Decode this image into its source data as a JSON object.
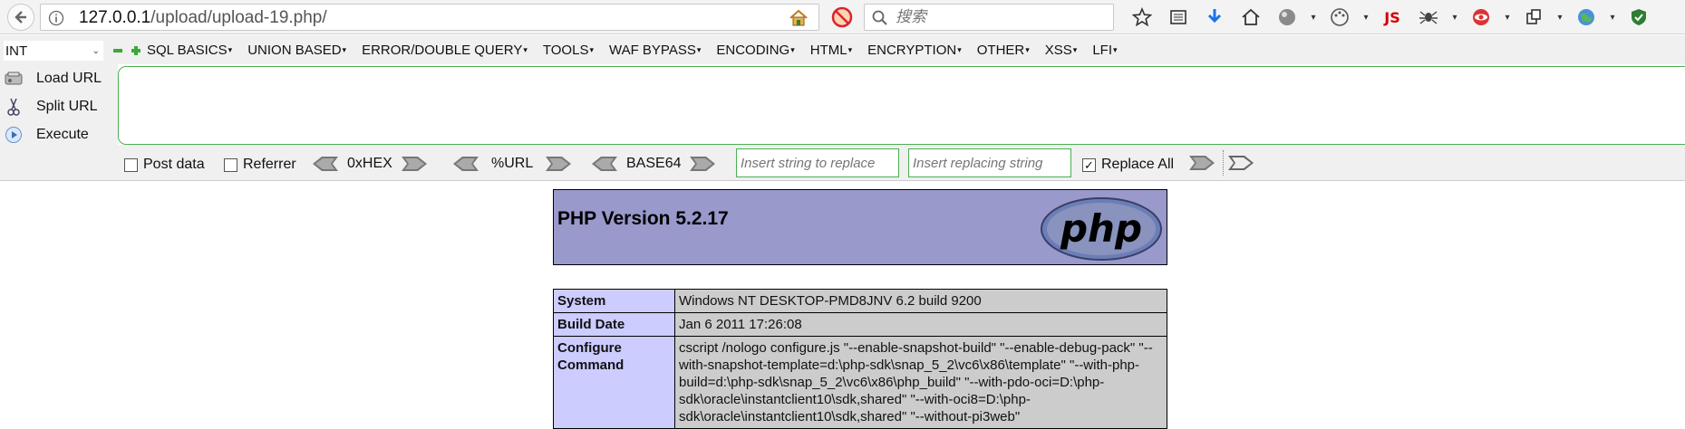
{
  "browser": {
    "url_host": "127.0.0.1",
    "url_path": "/upload/upload-19.php/",
    "search_placeholder": "搜索",
    "toolbar_icons": [
      "star-icon",
      "reader-icon",
      "download-icon",
      "home-icon",
      "addon-globe-icon",
      "palette-icon",
      "js-badge",
      "spider-icon",
      "eye-icon",
      "screenshot-icon",
      "globe-icon",
      "shield-icon"
    ],
    "js_label": "JS"
  },
  "hackbar": {
    "int_select": "INT",
    "menus": [
      "SQL BASICS",
      "UNION BASED",
      "ERROR/DOUBLE QUERY",
      "TOOLS",
      "WAF BYPASS",
      "ENCODING",
      "HTML",
      "ENCRYPTION",
      "OTHER",
      "XSS",
      "LFI"
    ],
    "actions": {
      "load_url": "Load URL",
      "split_url": "Split URL",
      "execute": "Execute"
    },
    "url_value": "",
    "post_data": "Post data",
    "referrer": "Referrer",
    "hex": "0xHEX",
    "url_enc": "%URL",
    "base64": "BASE64",
    "replace_placeholder": "Insert string to replace",
    "replacing_placeholder": "Insert replacing string",
    "replace_all": "Replace All",
    "replace_all_checked": true
  },
  "phpinfo": {
    "title": "PHP Version 5.2.17",
    "logo_text": "php",
    "rows": [
      {
        "key": "System",
        "value": "Windows NT DESKTOP-PMD8JNV 6.2 build 9200"
      },
      {
        "key": "Build Date",
        "value": "Jan 6 2011 17:26:08"
      },
      {
        "key": "Configure Command",
        "value": "cscript /nologo configure.js \"--enable-snapshot-build\" \"--enable-debug-pack\" \"--with-snapshot-template=d:\\php-sdk\\snap_5_2\\vc6\\x86\\template\" \"--with-php-build=d:\\php-sdk\\snap_5_2\\vc6\\x86\\php_build\" \"--with-pdo-oci=D:\\php-sdk\\oracle\\instantclient10\\sdk,shared\" \"--with-oci8=D:\\php-sdk\\oracle\\instantclient10\\sdk,shared\" \"--without-pi3web\""
      }
    ]
  },
  "colors": {
    "php_header": "#9999cc",
    "php_key": "#ccccff",
    "php_value": "#cccccc",
    "hackbar_border": "#4caf50"
  }
}
